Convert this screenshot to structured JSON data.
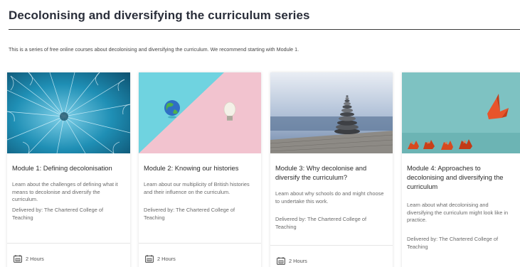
{
  "page": {
    "title": "Decolonising and diversifying the curriculum series",
    "intro": "This is a series of free online courses about decolonising and diversifying the curriculum. We recommend starting with Module 1."
  },
  "cards": [
    {
      "title": "Module 1: Defining decolonisation",
      "description": "Learn about the challenges of defining what it means to decolonise and diversify the curriculum.",
      "delivered_by": "Delivered by: The Chartered College of Teaching",
      "duration": "2 Hours",
      "image_icon": "dandelion-seeds-image"
    },
    {
      "title": "Module 2: Knowing our histories",
      "description": "Learn about our multiplicity of British histories and their influence on the curriculum.",
      "delivered_by": "Delivered by: The Chartered College of Teaching",
      "duration": "2 Hours",
      "image_icon": "globe-lightbulb-image"
    },
    {
      "title": "Module 3: Why decolonise and diversify the curriculum?",
      "description": "Learn about why schools do and might choose to undertake this work.",
      "delivered_by": "Delivered by: The Chartered College of Teaching",
      "duration": "2 Hours",
      "image_icon": "stacked-stones-image"
    },
    {
      "title": "Module 4: Approaches to decolonising and diversifying the curriculum",
      "description": "Learn about what decolonising and diversifying the curriculum might look like in practice.",
      "delivered_by": "Delivered by: The Chartered College of Teaching",
      "duration": "",
      "image_icon": "paper-crane-image"
    }
  ],
  "colors": {
    "title": "#2a2e3a",
    "card_text": "#6a6a6a",
    "calendar_icon": "#444444"
  }
}
